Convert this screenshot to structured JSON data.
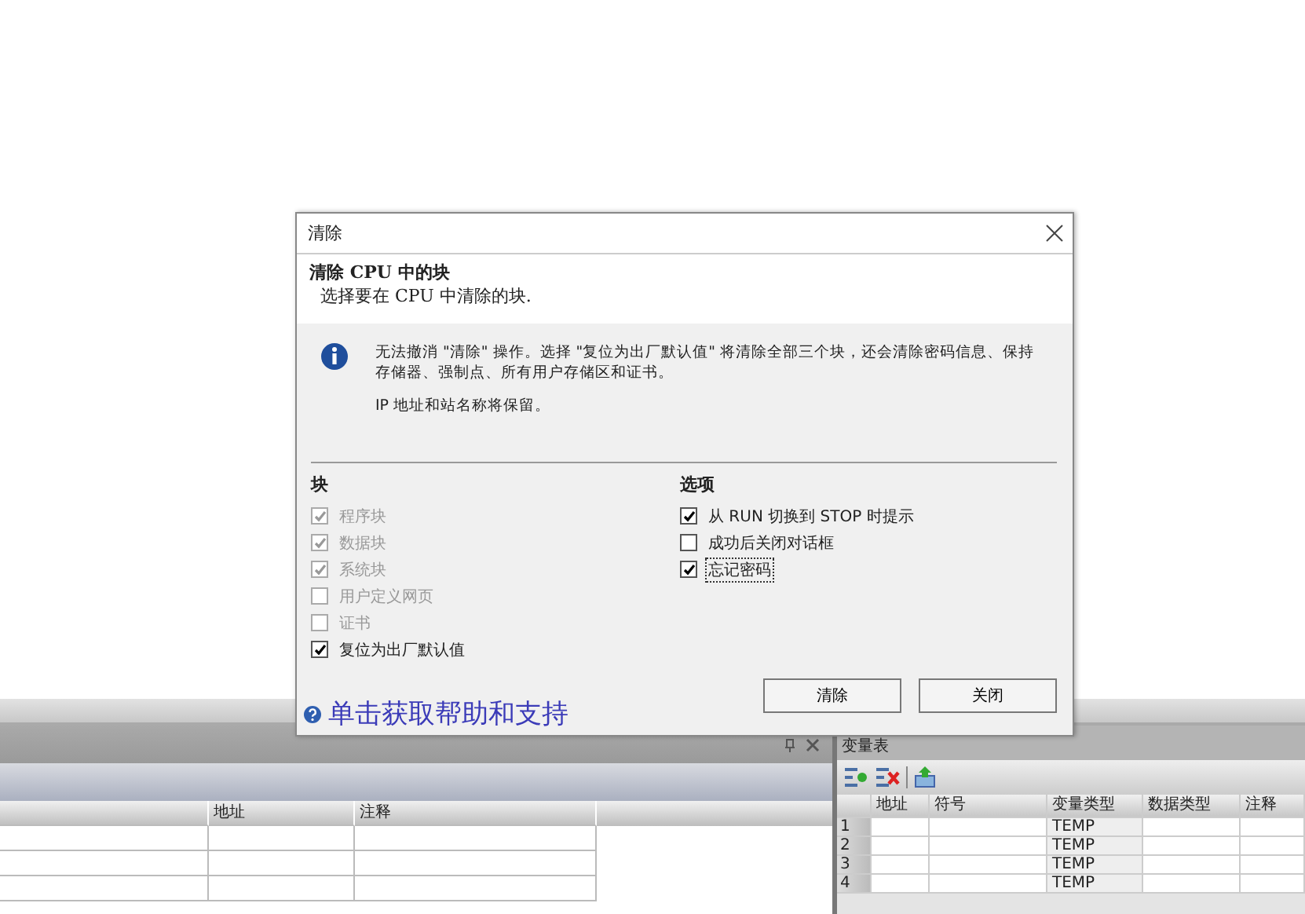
{
  "left_panel": {
    "columns": [
      {
        "label": "地址"
      },
      {
        "label": "注释"
      }
    ]
  },
  "variable_table": {
    "title": "变量表",
    "columns": [
      {
        "label": "地址"
      },
      {
        "label": "符号"
      },
      {
        "label": "变量类型"
      },
      {
        "label": "数据类型"
      },
      {
        "label": "注释"
      }
    ],
    "rows": [
      {
        "number": "1",
        "var_type": "TEMP"
      },
      {
        "number": "2",
        "var_type": "TEMP"
      },
      {
        "number": "3",
        "var_type": "TEMP"
      },
      {
        "number": "4",
        "var_type": "TEMP"
      }
    ]
  },
  "dialog": {
    "title": "清除",
    "heading": "清除  CPU  中的块",
    "subheading": "选择要在  CPU  中清除的块.",
    "info_text": "无法撤消 \"清除\" 操作。选择 \"复位为出厂默认值\" 将清除全部三个块，还会清除密码信息、保持存储器、强制点、所有用户存储区和证书。",
    "info_note": "IP 地址和站名称将保留。",
    "blocks": {
      "heading": "块",
      "items": [
        {
          "label": "程序块",
          "checked": true,
          "disabled": true
        },
        {
          "label": "数据块",
          "checked": true,
          "disabled": true
        },
        {
          "label": "系统块",
          "checked": true,
          "disabled": true
        },
        {
          "label": "用户定义网页",
          "checked": false,
          "disabled": true
        },
        {
          "label": "证书",
          "checked": false,
          "disabled": true
        },
        {
          "label": "复位为出厂默认值",
          "checked": true,
          "disabled": false
        }
      ]
    },
    "options": {
      "heading": "选项",
      "items": [
        {
          "label": "从 RUN 切换到 STOP 时提示",
          "checked": true,
          "focused": false
        },
        {
          "label": "成功后关闭对话框",
          "checked": false,
          "focused": false
        },
        {
          "label": "忘记密码",
          "checked": true,
          "focused": true
        }
      ]
    },
    "buttons": [
      {
        "label": "清除"
      },
      {
        "label": "关闭"
      }
    ],
    "help_link": "单击获取帮助和支持"
  }
}
